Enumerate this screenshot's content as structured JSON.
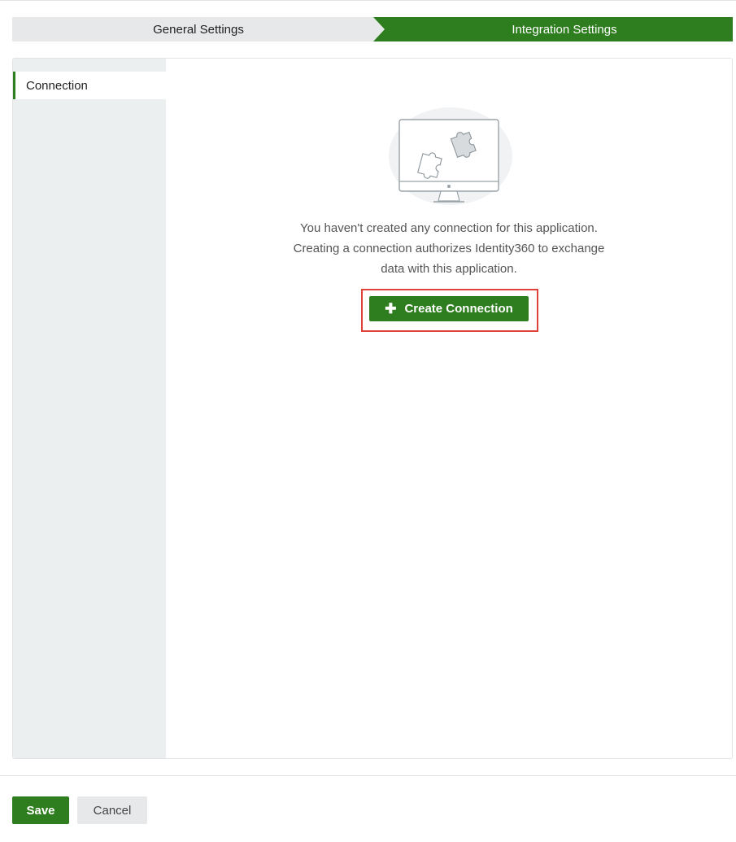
{
  "stepper": {
    "steps": [
      {
        "label": "General Settings",
        "state": "inactive"
      },
      {
        "label": "Integration Settings",
        "state": "active"
      }
    ]
  },
  "sidebar": {
    "items": [
      {
        "label": "Connection",
        "selected": true
      }
    ]
  },
  "empty_state": {
    "illustration": "monitor-with-puzzle-pieces",
    "lines": [
      "You haven't created any connection for this application.",
      "Creating a connection authorizes Identity360 to exchange",
      "data with this application."
    ],
    "create_button": {
      "icon": "plus-icon",
      "label": "Create Connection"
    }
  },
  "footer": {
    "save_label": "Save",
    "cancel_label": "Cancel"
  },
  "colors": {
    "accent": "#2e7d1e",
    "inactive_step": "#e6e8e9",
    "sidebar_bg": "#eceff0",
    "highlight": "#e0413a"
  }
}
